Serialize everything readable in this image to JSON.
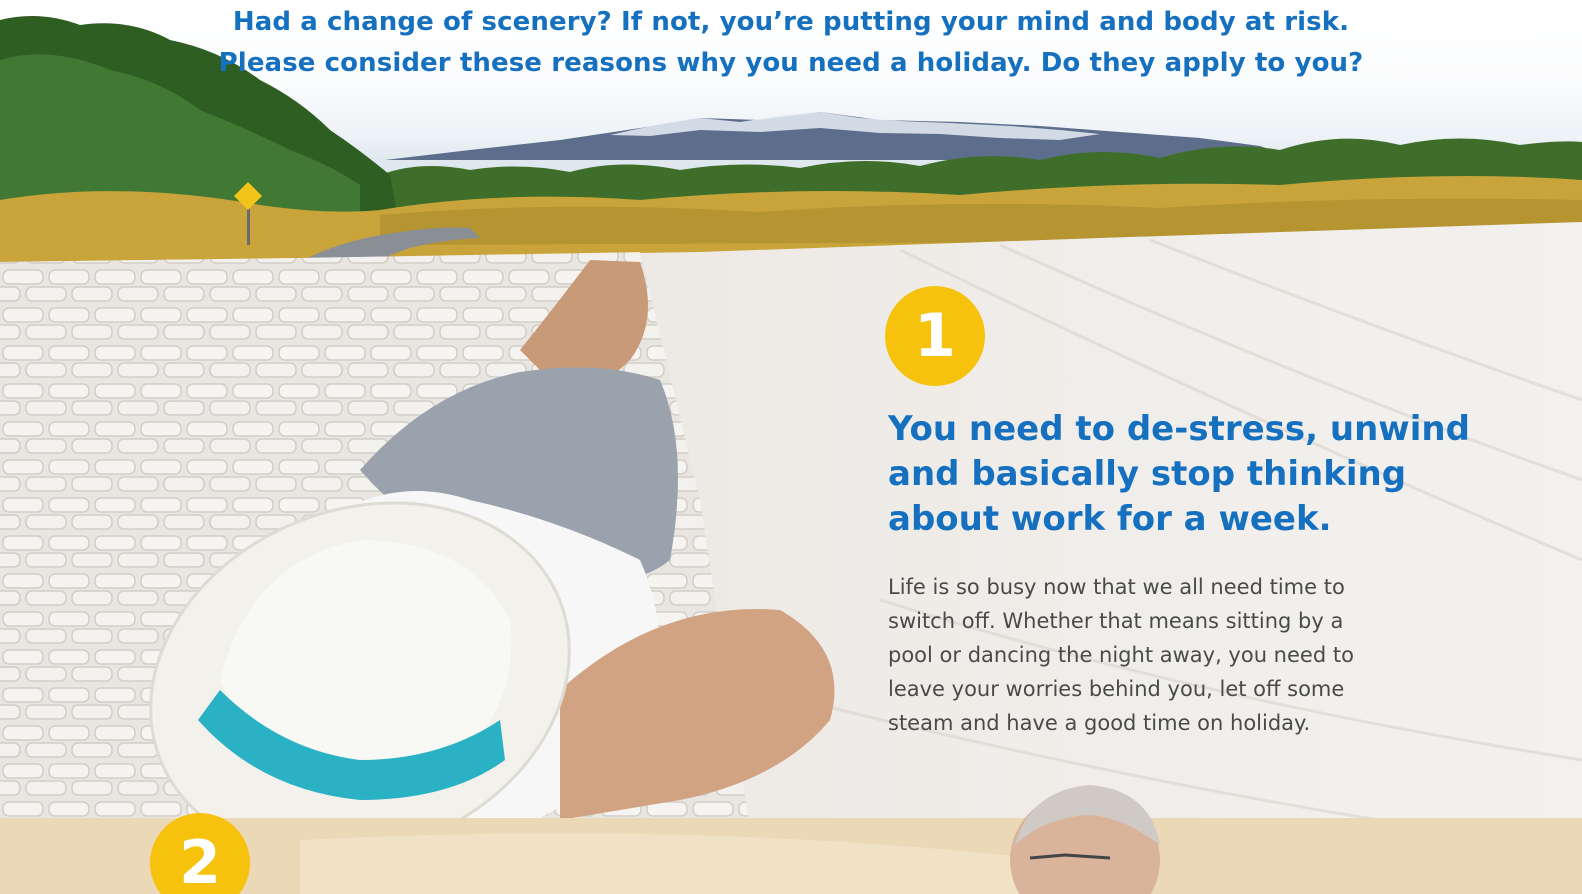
{
  "header": {
    "lines": [
      "Had a change of scenery? If not, you’re putting your mind and body at risk.",
      "Please consider these reasons why you need a holiday. Do they apply to you?"
    ]
  },
  "reasons": [
    {
      "number": "1",
      "title_lines": [
        "You need to de-stress, unwind",
        "and basically stop thinking",
        "about work for a week."
      ],
      "body_lines": [
        "Life is so busy now that we all need time to",
        "switch off. Whether that means sitting by a",
        "pool or dancing the night away, you need to",
        "leave your worries behind you, let off some",
        "steam and have a good time on holiday."
      ]
    },
    {
      "number": "2"
    }
  ],
  "colors": {
    "headline_blue": "#1570c0",
    "badge_yellow": "#f7c20e",
    "body_text": "#4a4a4a"
  }
}
